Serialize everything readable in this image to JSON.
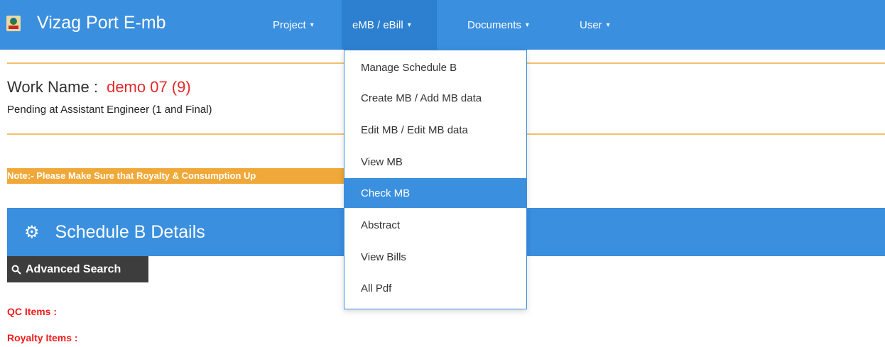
{
  "header": {
    "brand": "Vizag Port E-mb",
    "menu": [
      {
        "label": "Project"
      },
      {
        "label": "eMB / eBill"
      },
      {
        "label": "Documents"
      },
      {
        "label": "User"
      }
    ],
    "caret": "▾"
  },
  "dropdown": {
    "items": [
      {
        "label": "Manage Schedule B"
      },
      {
        "label": "Create MB / Add MB data"
      },
      {
        "label": "Edit MB / Edit MB data"
      },
      {
        "label": "View MB"
      },
      {
        "label": "Check MB"
      },
      {
        "label": "Abstract"
      },
      {
        "label": "View Bills"
      },
      {
        "label": "All Pdf"
      }
    ],
    "active_item": "Check MB"
  },
  "work": {
    "label": "Work Name :",
    "value": "demo 07  (9)",
    "status": "Pending at Assistant Engineer (1 and Final)"
  },
  "note": "Note:- Please Make Sure that Royalty & Consumption Up",
  "panel": {
    "title": "Schedule B Details",
    "icon": "gear-icon"
  },
  "search": {
    "label": "Advanced Search",
    "icon": "search-icon"
  },
  "labels": {
    "qc": "QC Items :",
    "royalty": "Royalty Items :"
  },
  "colors": {
    "primary": "#3a8fdf",
    "accent": "#f0a838",
    "danger": "#f01c1c",
    "dark": "#3d3d3d"
  }
}
